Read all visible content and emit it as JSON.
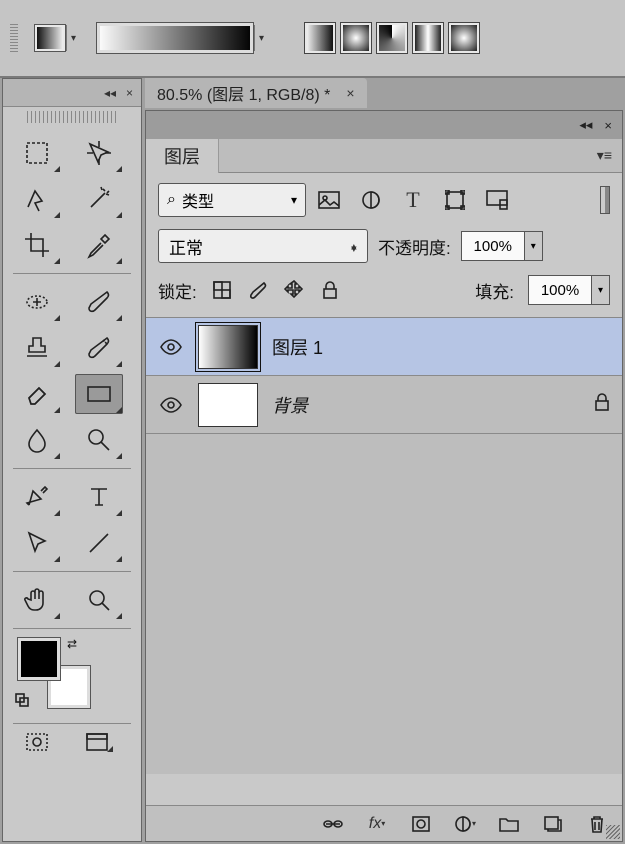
{
  "document": {
    "tab_label": "80.5% (图层 1, RGB/8) *"
  },
  "layers_panel": {
    "title": "图层",
    "filter": {
      "label": "类型"
    },
    "blend_row": {
      "mode": "正常",
      "opacity_label": "不透明度:",
      "opacity_value": "100%"
    },
    "lock_row": {
      "label": "锁定:",
      "fill_label": "填充:",
      "fill_value": "100%"
    },
    "layers": [
      {
        "name": "图层 1",
        "selected": true,
        "locked": false,
        "grad": true
      },
      {
        "name": "背景",
        "selected": false,
        "locked": true,
        "grad": false,
        "italic": true
      }
    ]
  },
  "icons": {
    "search": "⌕",
    "image": "▦",
    "adjust": "◐",
    "text": "T",
    "shape": "□",
    "smart": "⌗",
    "eye": "👁",
    "lock": "🔒",
    "link": "⊘",
    "fx": "fx",
    "mask": "▣",
    "fill": "◑",
    "group": "🗀",
    "new": "⧉",
    "trash": "🗑",
    "pixels": "▦",
    "brush": "✎",
    "move": "✥"
  }
}
